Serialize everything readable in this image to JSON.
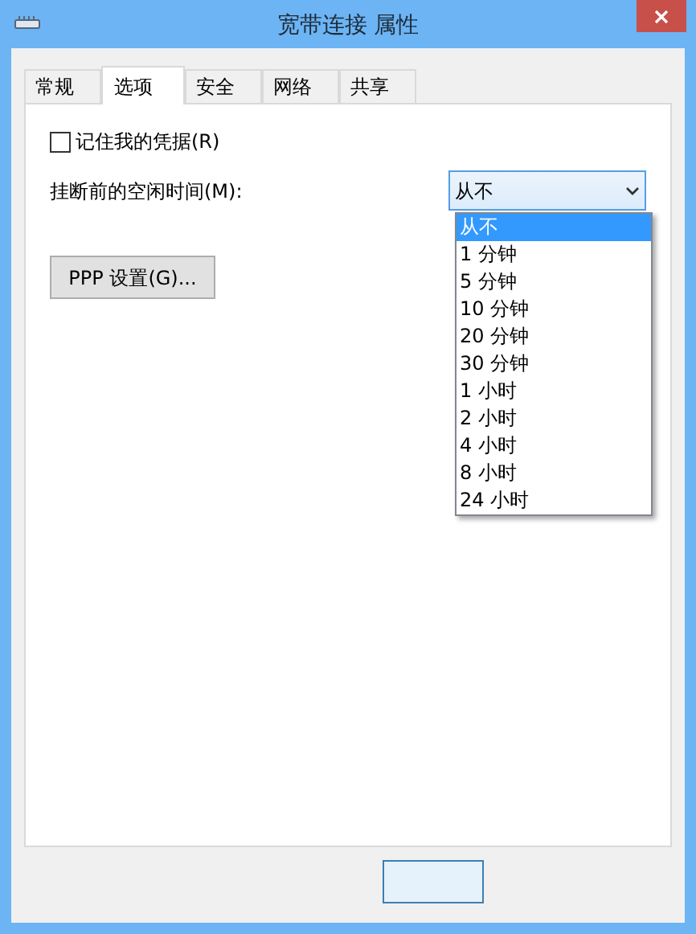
{
  "window": {
    "title": "宽带连接 属性"
  },
  "tabs": [
    {
      "label": "常规",
      "selected": false
    },
    {
      "label": "选项",
      "selected": true
    },
    {
      "label": "安全",
      "selected": false
    },
    {
      "label": "网络",
      "selected": false
    },
    {
      "label": "共享",
      "selected": false
    }
  ],
  "remember_credentials": {
    "label": "记住我的凭据(R)",
    "checked": false
  },
  "idle_time": {
    "label": "挂断前的空闲时间(M):",
    "value": "从不",
    "options": [
      {
        "label": "从不",
        "selected": true
      },
      {
        "label": "1 分钟",
        "selected": false
      },
      {
        "label": "5 分钟",
        "selected": false
      },
      {
        "label": "10 分钟",
        "selected": false
      },
      {
        "label": "20 分钟",
        "selected": false
      },
      {
        "label": "30 分钟",
        "selected": false
      },
      {
        "label": "1 小时",
        "selected": false
      },
      {
        "label": "2 小时",
        "selected": false
      },
      {
        "label": "4 小时",
        "selected": false
      },
      {
        "label": "8 小时",
        "selected": false
      },
      {
        "label": "24 小时",
        "selected": false
      }
    ]
  },
  "ppp_button": "PPP 设置(G)..."
}
